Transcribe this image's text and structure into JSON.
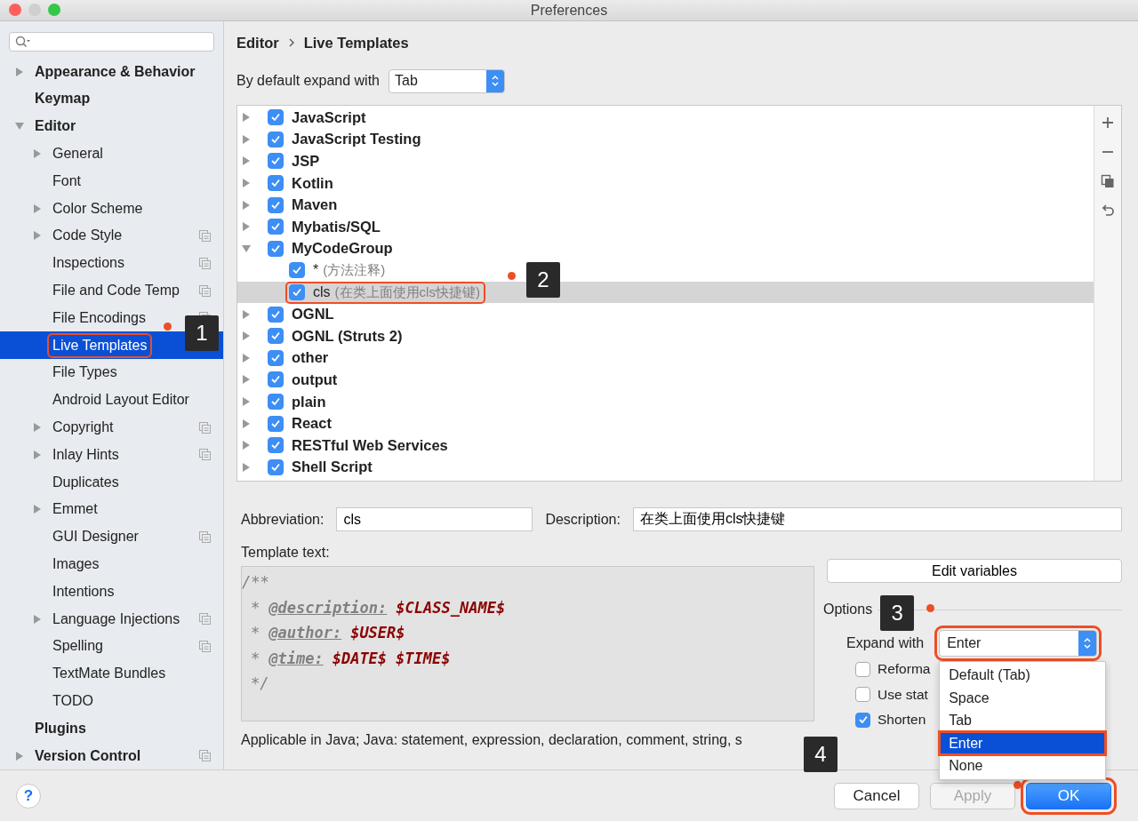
{
  "window": {
    "title": "Preferences"
  },
  "sidebar": {
    "items": [
      {
        "label": "Appearance & Behavior",
        "kind": "expandable",
        "expanded": false,
        "selected": false,
        "per_project": false
      },
      {
        "label": "Keymap",
        "kind": "leaf",
        "selected": false,
        "per_project": false
      },
      {
        "label": "Editor",
        "kind": "expandable",
        "expanded": true,
        "selected": false,
        "per_project": false,
        "children": [
          {
            "label": "General",
            "kind": "expandable",
            "expanded": false,
            "selected": false,
            "per_project": false
          },
          {
            "label": "Font",
            "kind": "leaf",
            "selected": false,
            "per_project": false
          },
          {
            "label": "Color Scheme",
            "kind": "expandable",
            "expanded": false,
            "selected": false,
            "per_project": false
          },
          {
            "label": "Code Style",
            "kind": "expandable",
            "expanded": false,
            "selected": false,
            "per_project": true
          },
          {
            "label": "Inspections",
            "kind": "leaf",
            "selected": false,
            "per_project": true
          },
          {
            "label": "File and Code Temp",
            "kind": "leaf",
            "selected": false,
            "per_project": true
          },
          {
            "label": "File Encodings",
            "kind": "leaf",
            "selected": false,
            "per_project": true
          },
          {
            "label": "Live Templates",
            "kind": "leaf",
            "selected": true,
            "per_project": false,
            "callout": "1"
          },
          {
            "label": "File Types",
            "kind": "leaf",
            "selected": false,
            "per_project": false
          },
          {
            "label": "Android Layout Editor",
            "kind": "leaf",
            "selected": false,
            "per_project": false
          },
          {
            "label": "Copyright",
            "kind": "expandable",
            "expanded": false,
            "selected": false,
            "per_project": true
          },
          {
            "label": "Inlay Hints",
            "kind": "expandable",
            "expanded": false,
            "selected": false,
            "per_project": true
          },
          {
            "label": "Duplicates",
            "kind": "leaf",
            "selected": false,
            "per_project": false
          },
          {
            "label": "Emmet",
            "kind": "expandable",
            "expanded": false,
            "selected": false,
            "per_project": false
          },
          {
            "label": "GUI Designer",
            "kind": "leaf",
            "selected": false,
            "per_project": true
          },
          {
            "label": "Images",
            "kind": "leaf",
            "selected": false,
            "per_project": false
          },
          {
            "label": "Intentions",
            "kind": "leaf",
            "selected": false,
            "per_project": false
          },
          {
            "label": "Language Injections",
            "kind": "expandable",
            "expanded": false,
            "selected": false,
            "per_project": true
          },
          {
            "label": "Spelling",
            "kind": "leaf",
            "selected": false,
            "per_project": true
          },
          {
            "label": "TextMate Bundles",
            "kind": "leaf",
            "selected": false,
            "per_project": false
          },
          {
            "label": "TODO",
            "kind": "leaf",
            "selected": false,
            "per_project": false
          }
        ]
      },
      {
        "label": "Plugins",
        "kind": "leaf",
        "selected": false,
        "per_project": false
      },
      {
        "label": "Version Control",
        "kind": "expandable",
        "expanded": false,
        "selected": false,
        "per_project": true
      }
    ]
  },
  "breadcrumb": [
    "Editor",
    "Live Templates"
  ],
  "default_expand": {
    "label": "By default expand with",
    "value": "Tab"
  },
  "templates": [
    {
      "label": "JavaScript",
      "checked": true,
      "expanded": false,
      "selected": false
    },
    {
      "label": "JavaScript Testing",
      "checked": true,
      "expanded": false,
      "selected": false
    },
    {
      "label": "JSP",
      "checked": true,
      "expanded": false,
      "selected": false
    },
    {
      "label": "Kotlin",
      "checked": true,
      "expanded": false,
      "selected": false
    },
    {
      "label": "Maven",
      "checked": true,
      "expanded": false,
      "selected": false
    },
    {
      "label": "Mybatis/SQL",
      "checked": true,
      "expanded": false,
      "selected": false
    },
    {
      "label": "MyCodeGroup",
      "checked": true,
      "expanded": true,
      "selected": false,
      "children": [
        {
          "label": "*",
          "description": "(方法注释)",
          "checked": true,
          "selected": false
        },
        {
          "label": "cls",
          "description": "(在类上面使用cls快捷键)",
          "checked": true,
          "selected": true,
          "callout": "2"
        }
      ]
    },
    {
      "label": "OGNL",
      "checked": true,
      "expanded": false,
      "selected": false
    },
    {
      "label": "OGNL (Struts 2)",
      "checked": true,
      "expanded": false,
      "selected": false
    },
    {
      "label": "other",
      "checked": true,
      "expanded": false,
      "selected": false
    },
    {
      "label": "output",
      "checked": true,
      "expanded": false,
      "selected": false
    },
    {
      "label": "plain",
      "checked": true,
      "expanded": false,
      "selected": false
    },
    {
      "label": "React",
      "checked": true,
      "expanded": false,
      "selected": false
    },
    {
      "label": "RESTful Web Services",
      "checked": true,
      "expanded": false,
      "selected": false
    },
    {
      "label": "Shell Script",
      "checked": true,
      "expanded": false,
      "selected": false
    }
  ],
  "form": {
    "abbreviation_label": "Abbreviation:",
    "abbreviation": "cls",
    "description_label": "Description:",
    "description": "在类上面使用cls快捷键"
  },
  "template_text": {
    "label": "Template text:",
    "lines": [
      [
        {
          "kind": "comment",
          "text": "/**"
        }
      ],
      [
        {
          "kind": "comment",
          "text": "*"
        },
        {
          "kind": "tag",
          "text": "@description:"
        },
        {
          "kind": "variable",
          "text": "$CLASS_NAME$"
        }
      ],
      [
        {
          "kind": "comment",
          "text": "*"
        },
        {
          "kind": "tag",
          "text": "@author:"
        },
        {
          "kind": "variable",
          "text": "$USER$"
        }
      ],
      [
        {
          "kind": "comment",
          "text": "*"
        },
        {
          "kind": "tag",
          "text": "@time:"
        },
        {
          "kind": "variable",
          "text": "$DATE$"
        },
        {
          "kind": "variable",
          "text": "$TIME$"
        }
      ],
      [
        {
          "kind": "comment",
          "text": "*/"
        }
      ]
    ]
  },
  "applicable": "Applicable in Java; Java: statement, expression, declaration, comment, string, s",
  "edit_variables": "Edit variables",
  "options": {
    "title": "Options",
    "expand_label": "Expand with",
    "expand_value": "Enter",
    "callout": "3",
    "checkboxes": [
      {
        "label": "Reforma",
        "checked": false
      },
      {
        "label": "Use stat",
        "checked": false
      },
      {
        "label": "Shorten",
        "checked": true
      }
    ],
    "dropdown": [
      {
        "label": "Default (Tab)",
        "selected": false,
        "highlighted": false
      },
      {
        "label": "Space",
        "selected": false,
        "highlighted": false
      },
      {
        "label": "Tab",
        "selected": false,
        "highlighted": false
      },
      {
        "label": "Enter",
        "selected": true,
        "highlighted": true
      },
      {
        "label": "None",
        "selected": false,
        "highlighted": false
      }
    ]
  },
  "help": "?",
  "buttons": [
    {
      "label": "Cancel",
      "kind": "normal"
    },
    {
      "label": "Apply",
      "kind": "disabled"
    },
    {
      "label": "OK",
      "kind": "default",
      "callout": "4"
    }
  ]
}
